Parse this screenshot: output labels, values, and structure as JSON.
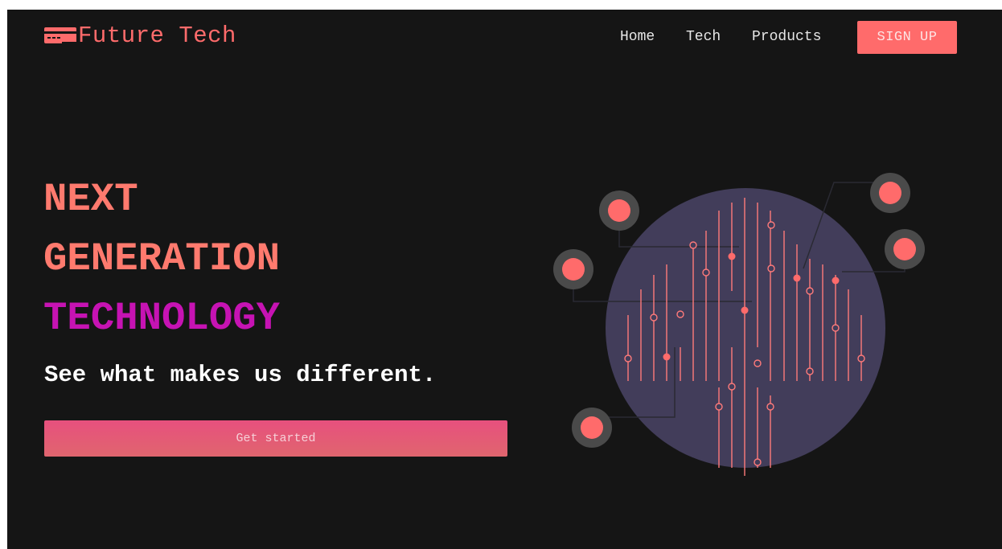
{
  "brand": {
    "logo_icon": "card-icon",
    "name": "Future Tech"
  },
  "nav": {
    "items": [
      {
        "label": "Home"
      },
      {
        "label": "Tech"
      },
      {
        "label": "Products"
      }
    ],
    "signup_label": "SIGN UP"
  },
  "hero": {
    "headline": [
      "NEXT",
      "GENERATION",
      "TECHNOLOGY"
    ],
    "tagline": "See what makes us different.",
    "cta_label": "Get started"
  },
  "illustration": {
    "icon": "circuit-globe-icon"
  },
  "colors": {
    "background": "#151515",
    "accent": "#ff6b6b",
    "headline_primary": "#ff7a6e",
    "headline_secondary": "#c613b3",
    "globe": "#423d5a"
  }
}
